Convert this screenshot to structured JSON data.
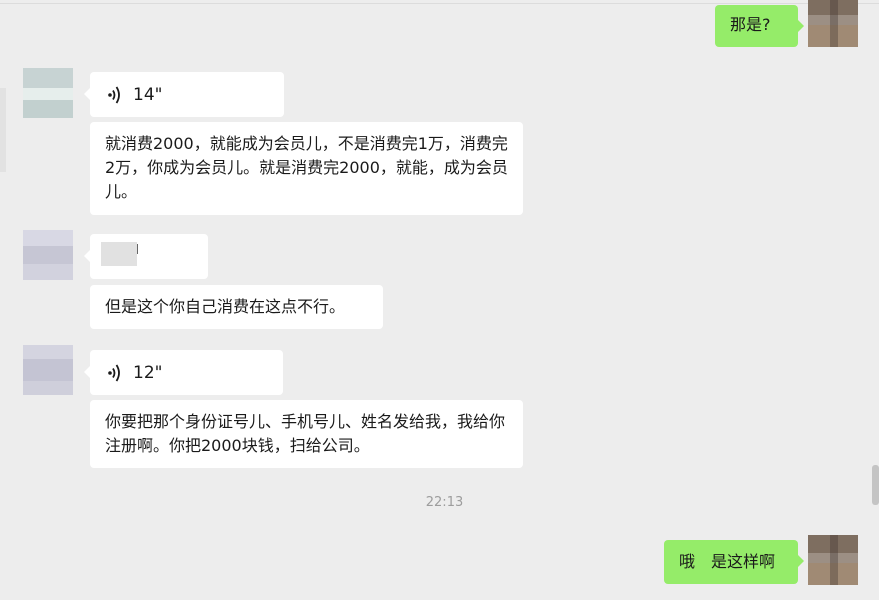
{
  "messages": {
    "m1": {
      "text": "那是?"
    },
    "m2": {
      "voice": "14\""
    },
    "m3": {
      "text": "就消费2000，就能成为会员儿，不是消费完1万，消费完2万，你成为会员儿。就是消费完2000，就能，成为会员儿。"
    },
    "m5": {
      "text": "但是这个你自己消费在这点不行。"
    },
    "m6": {
      "voice": "12\""
    },
    "m7": {
      "text": "你要把那个身份证号儿、手机号儿、姓名发给我，我给你注册啊。你把2000块钱，扫给公司。"
    },
    "m8": {
      "text": "哦　是这样啊"
    }
  },
  "timestamp": "22:13",
  "icons": {
    "voice": "voice-wave-icon"
  },
  "colors": {
    "background": "#ededed",
    "self_bubble": "#95ec69",
    "other_bubble": "#ffffff"
  }
}
